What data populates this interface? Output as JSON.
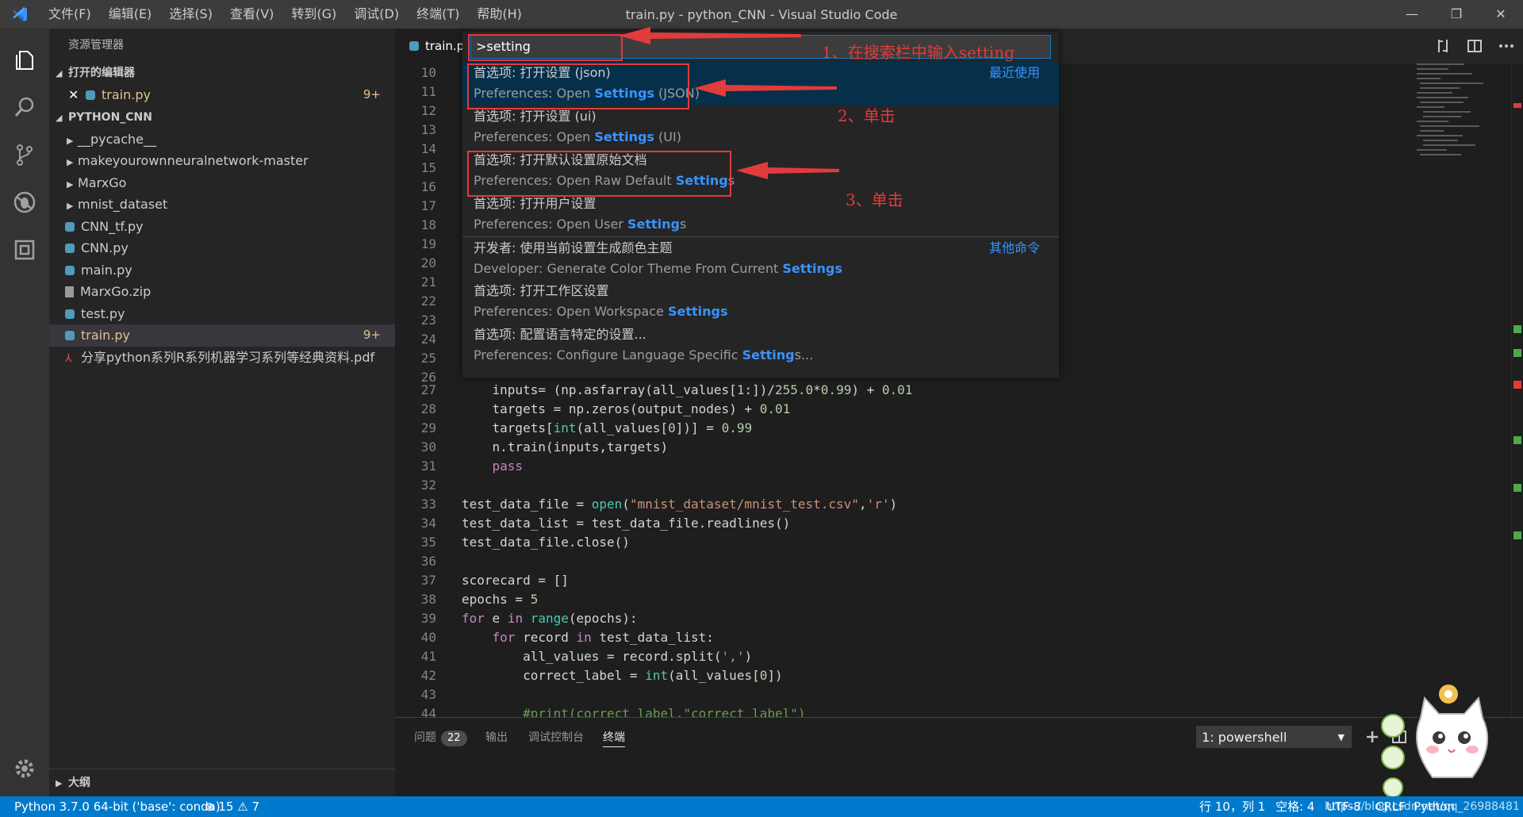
{
  "window": {
    "title": "train.py - python_CNN - Visual Studio Code",
    "menu": [
      "文件(F)",
      "编辑(E)",
      "选择(S)",
      "查看(V)",
      "转到(G)",
      "调试(D)",
      "终端(T)",
      "帮助(H)"
    ],
    "controls": {
      "minimize": "—",
      "restore": "❐",
      "close": "✕"
    }
  },
  "activity_bar": {
    "icons": [
      "files-icon",
      "search-icon",
      "source-control-icon",
      "debug-icon",
      "extensions-icon",
      "settings-gear-icon"
    ]
  },
  "sidebar": {
    "title": "资源管理器",
    "open_editors": {
      "header": "打开的编辑器",
      "items": [
        {
          "name": "train.py",
          "count": "9+"
        }
      ]
    },
    "project": {
      "header": "PYTHON_CNN",
      "folders": [
        "__pycache__",
        "makeyourownneuralnetwork-master",
        "MarxGo",
        "mnist_dataset"
      ],
      "files": [
        {
          "name": "CNN_tf.py",
          "type": "py"
        },
        {
          "name": "CNN.py",
          "type": "py"
        },
        {
          "name": "main.py",
          "type": "py"
        },
        {
          "name": "MarxGo.zip",
          "type": "zip"
        },
        {
          "name": "test.py",
          "type": "py"
        },
        {
          "name": "train.py",
          "type": "py",
          "count": "9+"
        },
        {
          "name": "分享python系列R系列机器学习系列等经典资料.pdf",
          "type": "pdf"
        }
      ]
    },
    "outline": "大纲"
  },
  "tab": {
    "label": "train.py"
  },
  "command_palette": {
    "input_value": ">setting",
    "items": [
      {
        "label": "首选项: 打开设置 (json)",
        "desc_pre": "Preferences: Open ",
        "desc_hl": "Settings",
        "desc_post": " (JSON)",
        "group": "最近使用"
      },
      {
        "label": "首选项: 打开设置 (ui)",
        "desc_pre": "Preferences: Open ",
        "desc_hl": "Settings",
        "desc_post": " (UI)",
        "group": ""
      },
      {
        "label": "首选项: 打开默认设置原始文档",
        "desc_pre": "Preferences: Open Raw Default ",
        "desc_hl": "Setting",
        "desc_post": "s",
        "group": ""
      },
      {
        "label": "首选项: 打开用户设置",
        "desc_pre": "Preferences: Open User ",
        "desc_hl": "Setting",
        "desc_post": "s",
        "group": ""
      },
      {
        "label": "开发者: 使用当前设置生成颜色主题",
        "desc_pre": "Developer: Generate Color Theme From Current ",
        "desc_hl": "Settings",
        "desc_post": "",
        "group": "其他命令"
      },
      {
        "label": "首选项: 打开工作区设置",
        "desc_pre": "Preferences: Open Workspace ",
        "desc_hl": "Settings",
        "desc_post": "",
        "group": ""
      },
      {
        "label": "首选项: 配置语言特定的设置...",
        "desc_pre": "Preferences: Configure Language Specific ",
        "desc_hl": "Setting",
        "desc_post": "s...",
        "group": ""
      }
    ]
  },
  "annotations": [
    "1、在搜索栏中输入setting",
    "2、单击",
    "3、单击"
  ],
  "editor": {
    "visible_line_numbers": [
      10,
      11,
      12,
      13,
      14,
      15,
      16,
      17,
      18,
      19,
      20,
      21,
      22,
      23,
      24,
      25,
      26
    ],
    "code": [
      {
        "n": 27,
        "text": "    inputs= (np.asfarray(all_values[1:])/255.0*0.99) + 0.01"
      },
      {
        "n": 28,
        "text": "    targets = np.zeros(output_nodes) + 0.01"
      },
      {
        "n": 29,
        "text": "    targets[int(all_values[0])] = 0.99"
      },
      {
        "n": 30,
        "text": "    n.train(inputs,targets)"
      },
      {
        "n": 31,
        "text": "    pass"
      },
      {
        "n": 32,
        "text": ""
      },
      {
        "n": 33,
        "text": "test_data_file = open(\"mnist_dataset/mnist_test.csv\",'r')"
      },
      {
        "n": 34,
        "text": "test_data_list = test_data_file.readlines()"
      },
      {
        "n": 35,
        "text": "test_data_file.close()"
      },
      {
        "n": 36,
        "text": ""
      },
      {
        "n": 37,
        "text": "scorecard = []"
      },
      {
        "n": 38,
        "text": "epochs = 5"
      },
      {
        "n": 39,
        "text": "for e in range(epochs):"
      },
      {
        "n": 40,
        "text": "    for record in test_data_list:"
      },
      {
        "n": 41,
        "text": "        all_values = record.split(',')"
      },
      {
        "n": 42,
        "text": "        correct_label = int(all_values[0])"
      },
      {
        "n": 43,
        "text": ""
      },
      {
        "n": 44,
        "text": "        #print(correct_label,\"correct_label\")"
      }
    ]
  },
  "panel": {
    "tabs": [
      "问题",
      "输出",
      "调试控制台",
      "终端"
    ],
    "problems_count": "22",
    "terminal_select": "1: powershell"
  },
  "status_bar": {
    "interpreter": "Python 3.7.0 64-bit ('base': conda)",
    "errors": "15",
    "warnings": "7",
    "position": "行 10，列 1",
    "spaces": "空格: 4",
    "encoding": "UTF-8",
    "eol": "CRLF",
    "language": "Python"
  },
  "watermark": "https://blog.csdn.net/qq_26988481"
}
